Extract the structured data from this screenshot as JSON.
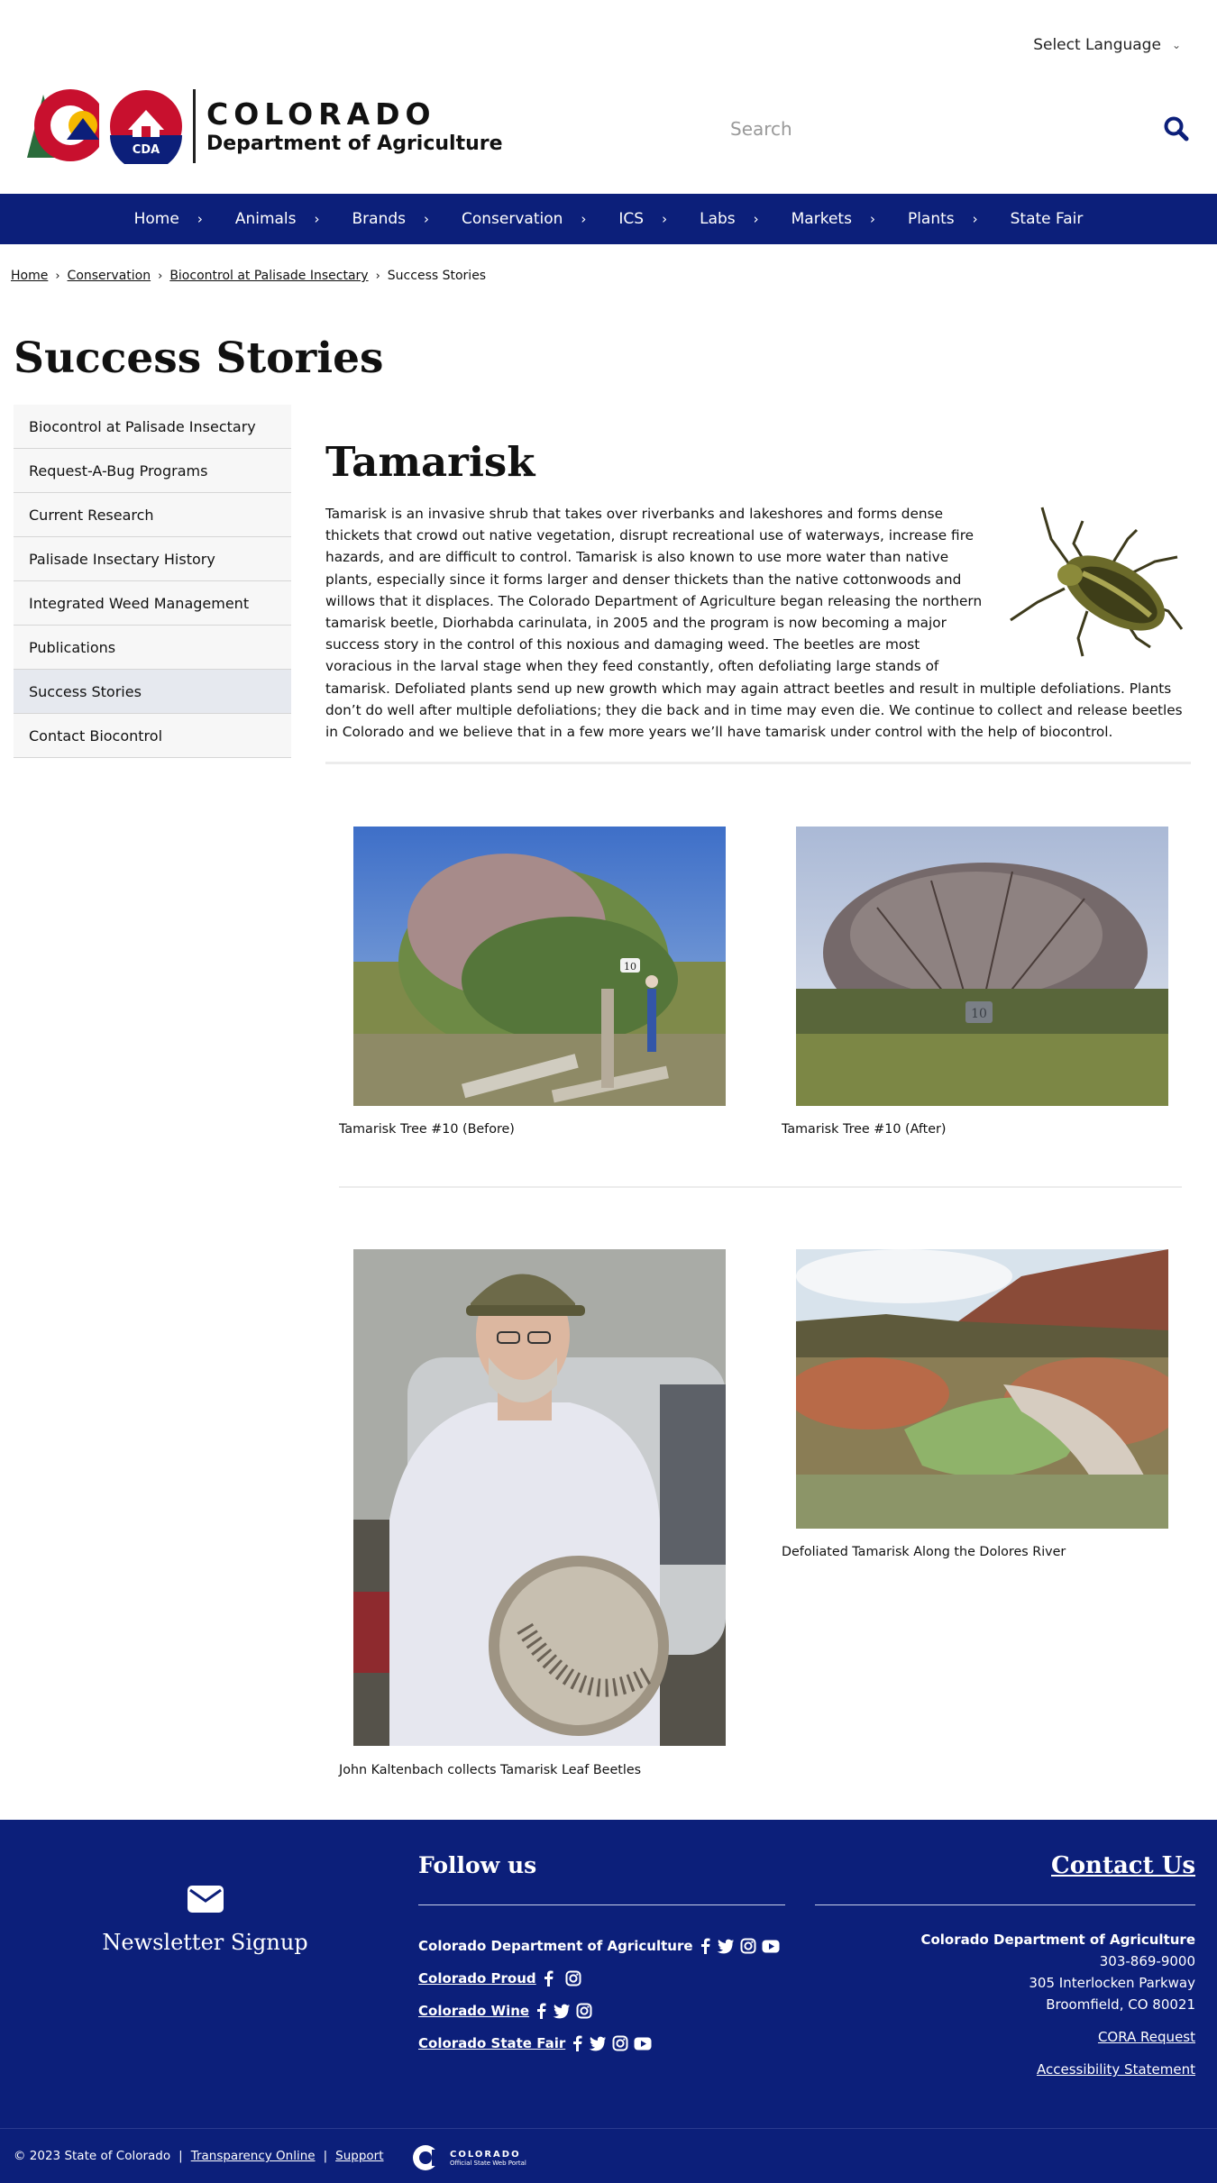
{
  "header": {
    "language_label": "Select Language",
    "logo_title": "COLORADO",
    "logo_subtitle": "Department of Agriculture",
    "logo_badge": "CDA",
    "search_placeholder": "Search"
  },
  "nav": {
    "items": [
      {
        "label": "Home"
      },
      {
        "label": "Animals"
      },
      {
        "label": "Brands"
      },
      {
        "label": "Conservation"
      },
      {
        "label": "ICS"
      },
      {
        "label": "Labs"
      },
      {
        "label": "Markets"
      },
      {
        "label": "Plants"
      },
      {
        "label": "State Fair"
      }
    ]
  },
  "breadcrumb": {
    "items": [
      "Home",
      "Conservation",
      "Biocontrol at Palisade Insectary"
    ],
    "current": "Success Stories"
  },
  "page_title": "Success Stories",
  "sidebar": {
    "items": [
      {
        "label": "Biocontrol at Palisade Insectary"
      },
      {
        "label": "Request-A-Bug Programs"
      },
      {
        "label": "Current Research"
      },
      {
        "label": "Palisade Insectary History"
      },
      {
        "label": "Integrated Weed Management"
      },
      {
        "label": "Publications"
      },
      {
        "label": "Success Stories",
        "active": true
      },
      {
        "label": "Contact Biocontrol"
      }
    ]
  },
  "main": {
    "title": "Tamarisk",
    "intro": "Tamarisk is an invasive shrub that takes over riverbanks and lakeshores and forms dense thickets that crowd out native vegetation, disrupt recreational use of waterways, increase fire hazards, and are difficult to control. Tamarisk is also known to use more water than native plants, especially since it forms larger and denser thickets than the native cottonwoods and willows that it displaces. The Colorado Department of Agriculture began releasing the northern tamarisk beetle, Diorhabda carinulata, in 2005 and the program is now becoming a major success story in the control of this noxious and damaging weed. The beetles are most voracious in the larval stage when they feed constantly, often defoliating large stands of tamarisk.  Defoliated plants send up new growth which may again attract beetles and result in multiple defoliations. Plants don’t do well after multiple defoliations; they die back and in time may even die. We continue to collect and release beetles in Colorado and we believe that in a few more years we’ll have tamarisk under control with the help of biocontrol.",
    "photos": [
      {
        "caption": "Tamarisk Tree #10 (Before)",
        "tag": "10"
      },
      {
        "caption": "Tamarisk Tree #10 (After)",
        "tag": "10"
      },
      {
        "caption": "John Kaltenbach collects Tamarisk Leaf Beetles"
      },
      {
        "caption": "Defoliated Tamarisk Along the Dolores River"
      }
    ]
  },
  "footer": {
    "newsletter": "Newsletter Signup",
    "follow_heading": "Follow us",
    "social": [
      {
        "name": "Colorado Department of Agriculture",
        "icons": [
          "facebook-icon",
          "twitter-icon",
          "instagram-icon",
          "youtube-icon"
        ]
      },
      {
        "name": "Colorado Proud",
        "icons": [
          "facebook-icon",
          "instagram-icon"
        ]
      },
      {
        "name": "Colorado Wine",
        "icons": [
          "facebook-icon",
          "twitter-icon",
          "instagram-icon"
        ]
      },
      {
        "name": "Colorado State Fair",
        "icons": [
          "facebook-icon",
          "twitter-icon",
          "instagram-icon",
          "youtube-icon"
        ]
      }
    ],
    "contact_heading": "Contact Us",
    "contact": {
      "org": "Colorado Department of Agriculture",
      "phone": "303-869-9000",
      "street": "305 Interlocken Parkway",
      "city": "Broomfield, CO 80021",
      "cora": "CORA Request",
      "accessibility": "Accessibility Statement"
    },
    "copyright": "© 2023 State of Colorado",
    "divider": "|",
    "transparency": "Transparency Online",
    "support": "Support",
    "portal_title": "COLORADO",
    "portal_subtitle": "Official State Web Portal"
  },
  "colors": {
    "nav_bg": "#0c1f7a",
    "footer_bg": "#0c1f7a",
    "logo_red": "#c8102e",
    "logo_green": "#2a6b3b",
    "logo_yellow": "#f5b800"
  }
}
